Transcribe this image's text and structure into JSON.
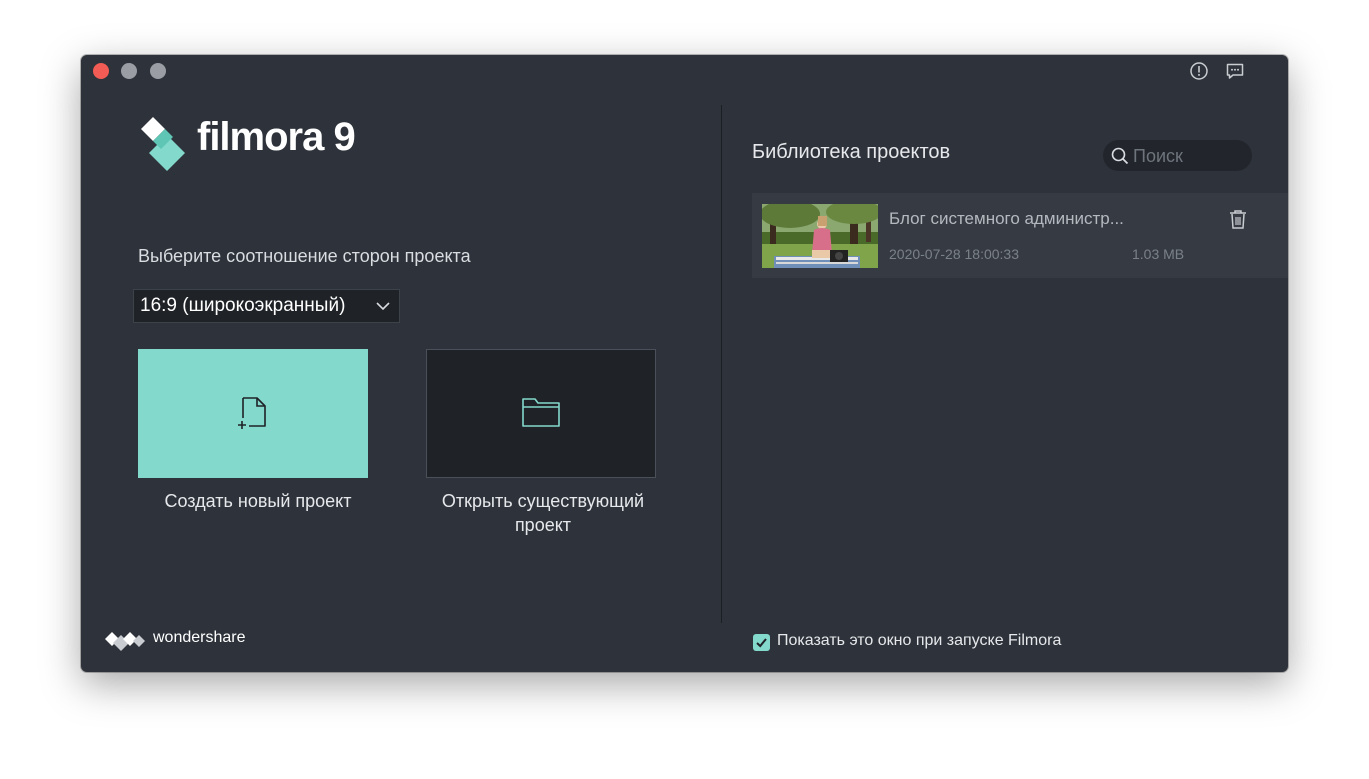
{
  "app": {
    "name_text": "filmora",
    "version_text": "9"
  },
  "aspect": {
    "label": "Выберите соотношение сторон проекта",
    "selected": "16:9 (широкоэкранный)"
  },
  "actions": {
    "new_project": "Создать новый проект",
    "open_project": "Открыть существующий проект"
  },
  "brand": {
    "name": "wondershare"
  },
  "library": {
    "title": "Библиотека проектов",
    "search_placeholder": "Поиск",
    "projects": [
      {
        "name": "Блог системного администр...",
        "date": "2020-07-28 18:00:33",
        "size": "1.03 MB"
      }
    ]
  },
  "startup": {
    "label": "Показать это окно при запуске Filmora",
    "checked": true
  },
  "colors": {
    "accent": "#83d9cb",
    "window_bg": "#2e333b",
    "close": "#f25c55"
  },
  "icons": {
    "info": "info-icon",
    "feedback": "feedback-icon",
    "search": "search-icon",
    "trash": "trash-icon",
    "new_file": "new-file-icon",
    "folder": "folder-icon",
    "chevron": "chevron-down-icon"
  }
}
